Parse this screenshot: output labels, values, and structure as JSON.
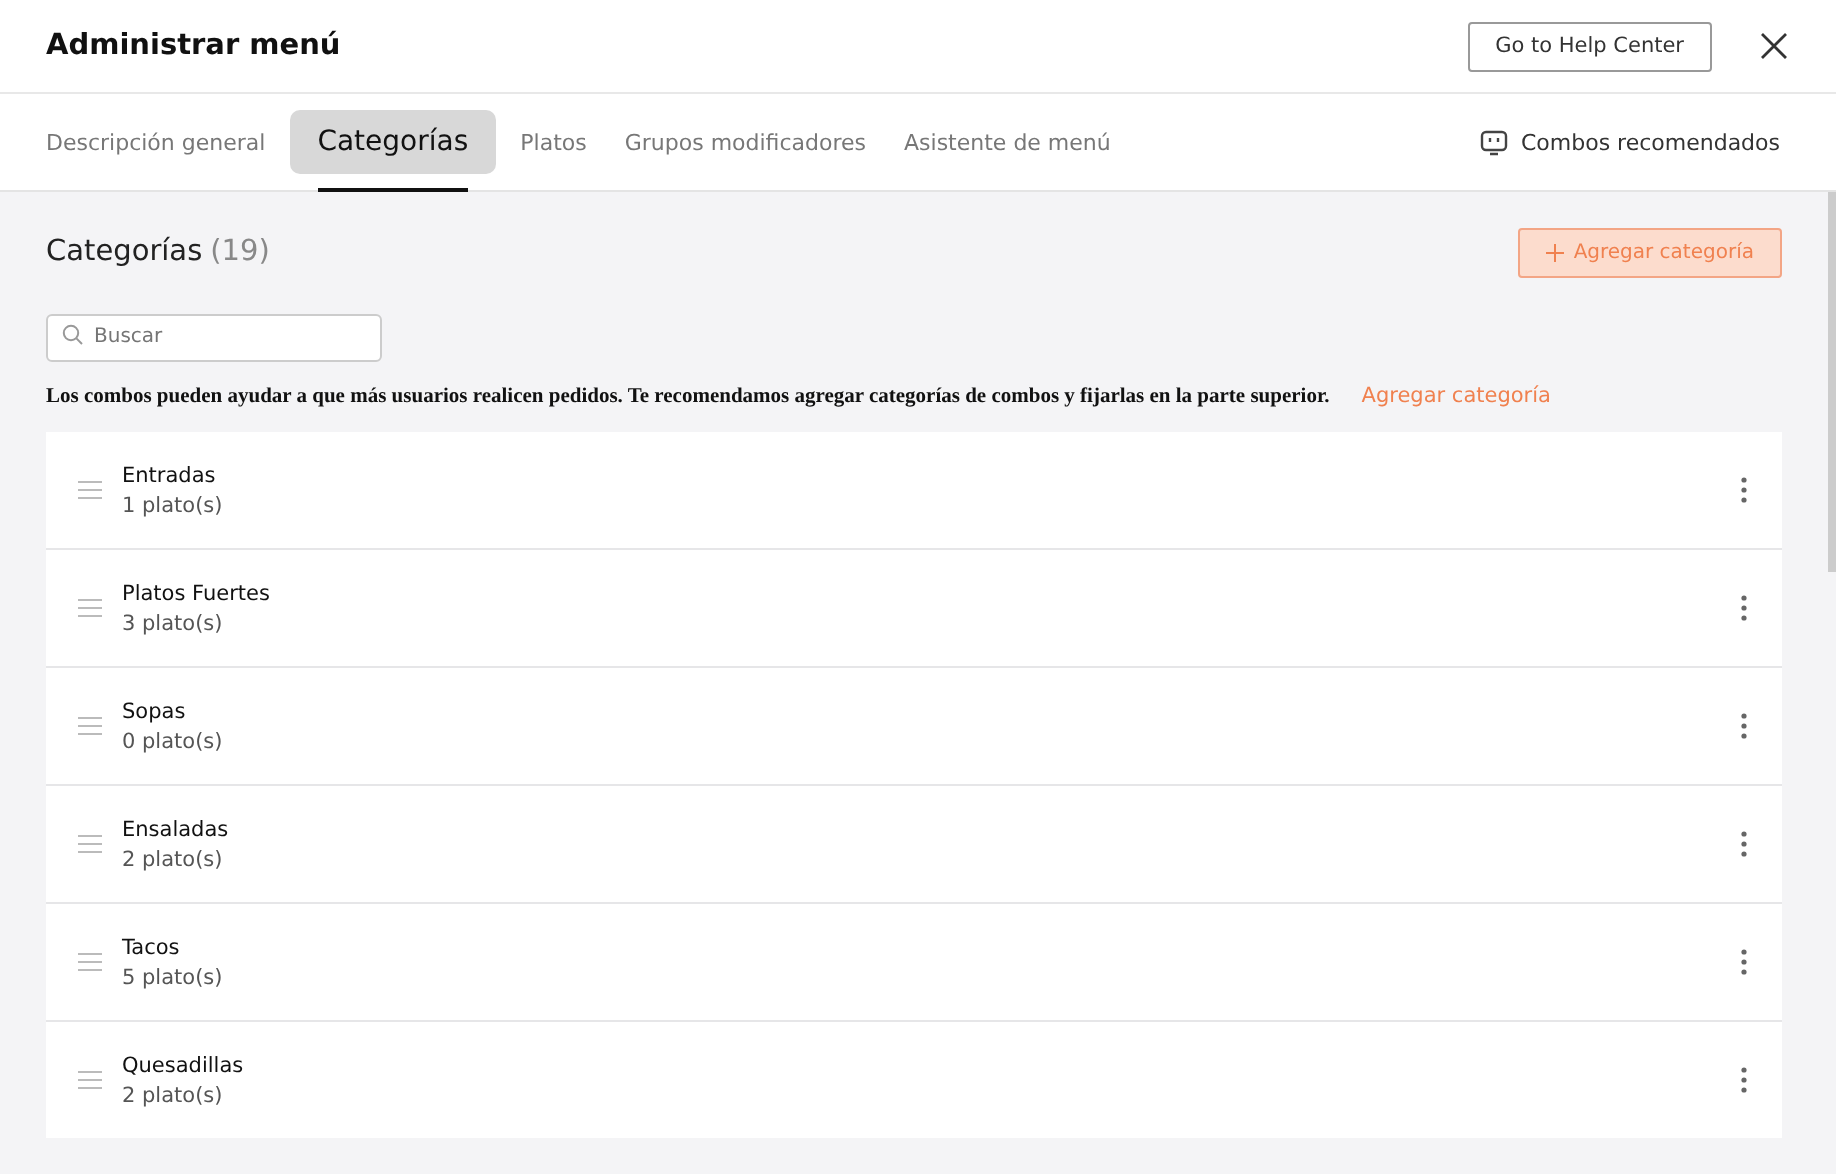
{
  "header": {
    "title": "Administrar menú",
    "help_button": "Go to Help Center"
  },
  "tabs": [
    {
      "label": "Descripción general",
      "selected": false
    },
    {
      "label": "Categorías",
      "selected": true
    },
    {
      "label": "Platos",
      "selected": false
    },
    {
      "label": "Grupos modificadores",
      "selected": false
    },
    {
      "label": "Asistente de menú",
      "selected": false
    }
  ],
  "combos_link": "Combos recomendados",
  "section": {
    "title": "Categorías",
    "count": "(19)",
    "add_button": "Agregar categoría"
  },
  "search": {
    "placeholder": "Buscar"
  },
  "notice": {
    "text": "Los combos pueden ayudar a que más usuarios realicen pedidos. Te recomendamos agregar categorías de combos y fijarlas en la parte superior.",
    "link": "Agregar categoría"
  },
  "categories": [
    {
      "name": "Entradas",
      "dishes": "1 plato(s)"
    },
    {
      "name": "Platos Fuertes",
      "dishes": "3 plato(s)"
    },
    {
      "name": "Sopas",
      "dishes": "0 plato(s)"
    },
    {
      "name": "Ensaladas",
      "dishes": "2 plato(s)"
    },
    {
      "name": "Tacos",
      "dishes": "5 plato(s)"
    },
    {
      "name": "Quesadillas",
      "dishes": "2 plato(s)"
    }
  ]
}
